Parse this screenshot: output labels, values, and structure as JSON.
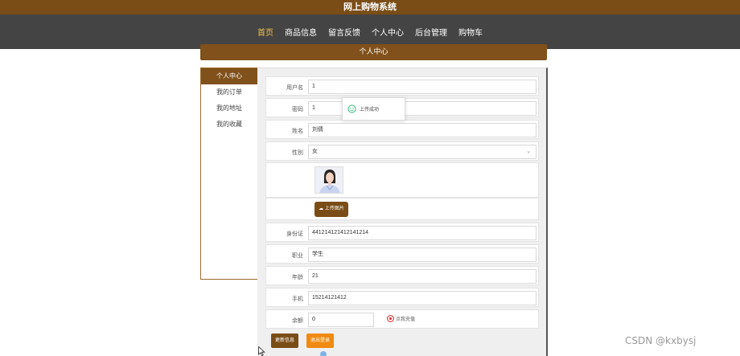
{
  "app_title": "网上购物系统",
  "nav": {
    "items": [
      "首页",
      "商品信息",
      "留言反馈",
      "个人中心",
      "后台管理",
      "购物车"
    ],
    "active_index": 0
  },
  "section_title": "个人中心",
  "sidebar": {
    "items": [
      "个人中心",
      "我的订单",
      "我的地址",
      "我的收藏"
    ],
    "active_index": 0
  },
  "form": {
    "username": {
      "label": "用户名",
      "value": "1"
    },
    "password": {
      "label": "密码",
      "value": "1"
    },
    "name": {
      "label": "姓名",
      "value": "刘倩"
    },
    "gender": {
      "label": "性别",
      "value": "女"
    },
    "upload_button": "上传图片",
    "id_card": {
      "label": "身份证",
      "value": "441214121412141214"
    },
    "job": {
      "label": "职业",
      "value": "学生"
    },
    "age": {
      "label": "年龄",
      "value": "21"
    },
    "phone": {
      "label": "手机",
      "value": "15214121412"
    },
    "balance": {
      "label": "余额",
      "value": "0",
      "recharge": "点我充值"
    }
  },
  "buttons": {
    "update": "更新信息",
    "logout": "退出登录"
  },
  "toast": {
    "message": "上传成功"
  },
  "watermark": "CSDN @kxbysj",
  "colors": {
    "brand": "#7a4d17",
    "nav_bg": "#444444",
    "nav_active": "#f3c24b",
    "logout": "#f08a10"
  }
}
